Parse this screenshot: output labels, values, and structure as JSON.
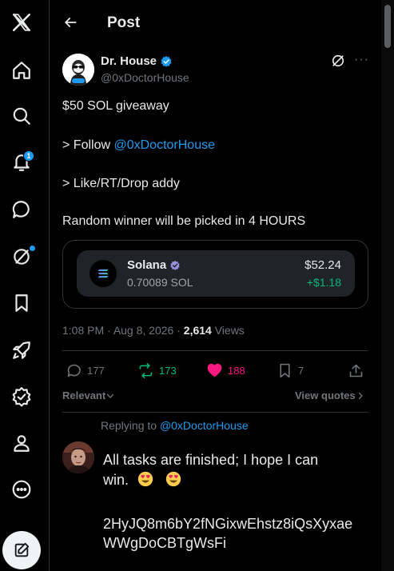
{
  "nav": {
    "notifications_badge": "1"
  },
  "header": {
    "title": "Post"
  },
  "post": {
    "author_name": "Dr. House",
    "author_handle": "@0xDoctorHouse",
    "line1": "$50 SOL giveaway",
    "line2_prefix": "> Follow ",
    "line2_mention": "@0xDoctorHouse",
    "line3": "> Like/RT/Drop addy",
    "line4": "Random winner will be picked in 4 HOURS",
    "wallet": {
      "token_name": "Solana",
      "token_amount": "0.70089 SOL",
      "usd_value": "$52.24",
      "usd_change": "+$1.18"
    },
    "time": "1:08 PM",
    "date": "Aug 8, 2026",
    "views_count": "2,614",
    "views_label": "Views",
    "actions": {
      "replies": "177",
      "reposts": "173",
      "likes": "188",
      "bookmarks": "7"
    },
    "sort_label": "Relevant",
    "view_quotes_label": "View quotes"
  },
  "reply": {
    "replying_prefix": "Replying to ",
    "replying_mention": "@0xDoctorHouse",
    "text_line1": "All tasks are finished; I hope I can",
    "text_line2": "win.",
    "text_line3": "2HyJQ8m6bY2fNGixwEhstz8iQsXyxae",
    "text_line4": "WWgDoCBTgWsFi"
  },
  "colors": {
    "background": "#000000",
    "accent": "#1d9bf0",
    "repost_green": "#00ba7c",
    "like_pink": "#f91880",
    "muted": "#71767b"
  }
}
